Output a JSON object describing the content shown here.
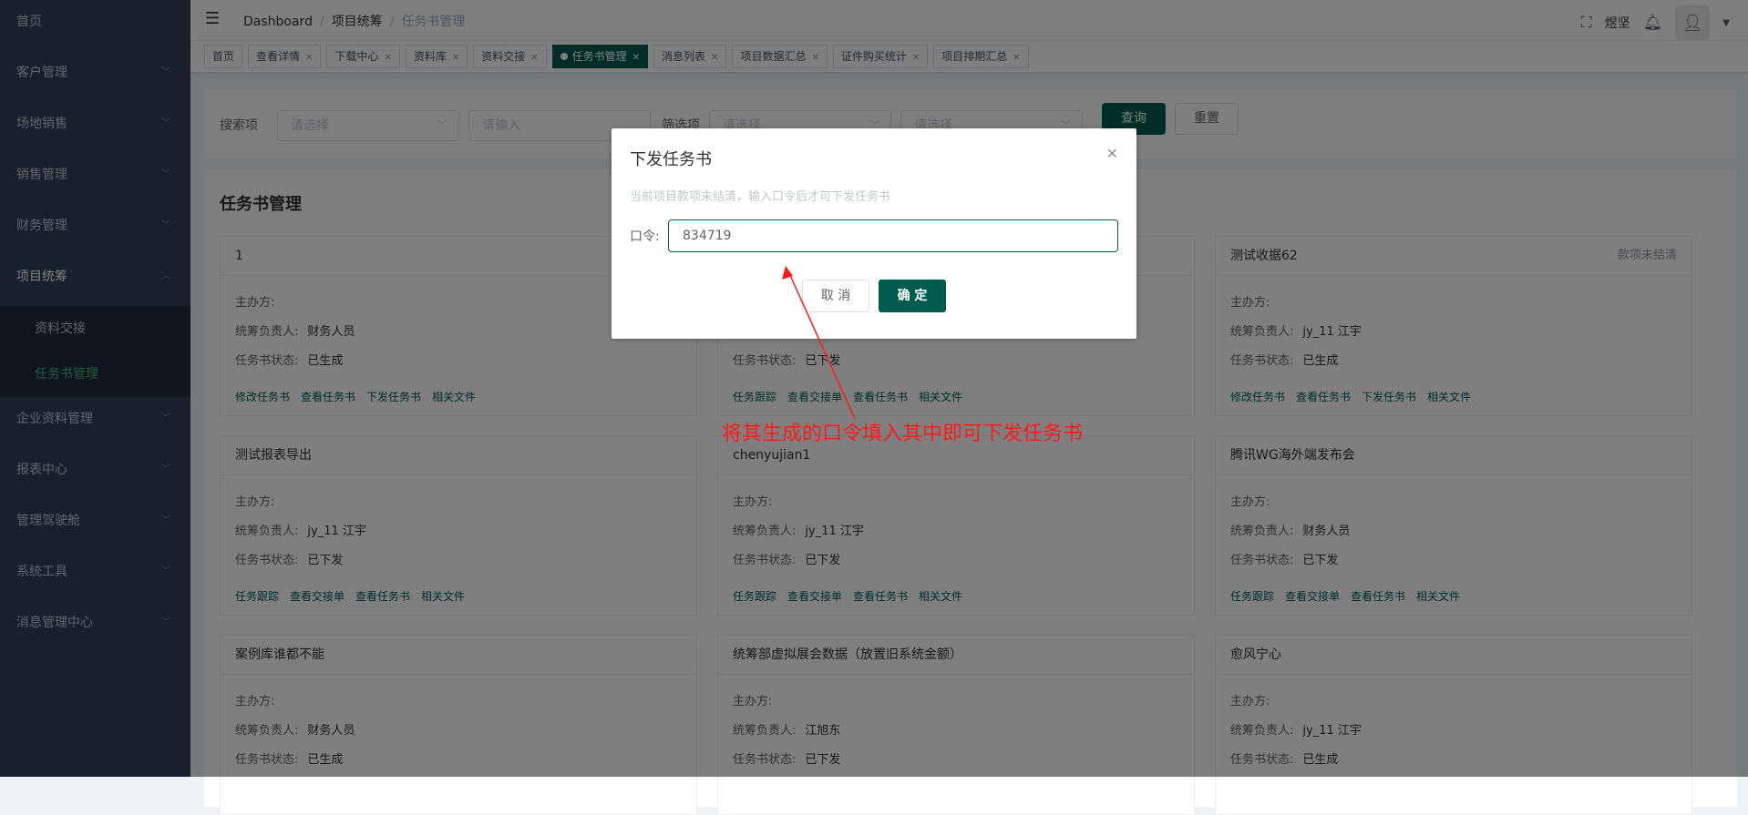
{
  "sidebar": {
    "items": [
      {
        "label": "首页",
        "chevron": false
      },
      {
        "label": "客户管理",
        "chevron": true
      },
      {
        "label": "场地销售",
        "chevron": true
      },
      {
        "label": "销售管理",
        "chevron": true
      },
      {
        "label": "财务管理",
        "chevron": true
      },
      {
        "label": "项目统筹",
        "chevron": true
      },
      {
        "label": "企业资料管理",
        "chevron": true
      },
      {
        "label": "报表中心",
        "chevron": true
      },
      {
        "label": "管理驾驶舱",
        "chevron": true
      },
      {
        "label": "系统工具",
        "chevron": true
      },
      {
        "label": "消息管理中心",
        "chevron": true
      }
    ],
    "subitems": [
      "资料交接",
      "任务书管理"
    ]
  },
  "navbar": {
    "breadcrumb": [
      "Dashboard",
      "项目统筹",
      "任务书管理"
    ],
    "user": "煜坚"
  },
  "tags": [
    {
      "label": "首页",
      "closable": false,
      "active": false
    },
    {
      "label": "查看详情",
      "closable": true,
      "active": false
    },
    {
      "label": "下载中心",
      "closable": true,
      "active": false
    },
    {
      "label": "资料库",
      "closable": true,
      "active": false
    },
    {
      "label": "资料交接",
      "closable": true,
      "active": false
    },
    {
      "label": "任务书管理",
      "closable": true,
      "active": true
    },
    {
      "label": "消息列表",
      "closable": true,
      "active": false
    },
    {
      "label": "项目数据汇总",
      "closable": true,
      "active": false
    },
    {
      "label": "证件购买统计",
      "closable": true,
      "active": false
    },
    {
      "label": "项目排期汇总",
      "closable": true,
      "active": false
    }
  ],
  "search": {
    "search_label": "搜索项",
    "select_placeholder": "请选择",
    "input_placeholder": "请输入",
    "filter_label": "筛选项",
    "filter1_placeholder": "请选择",
    "filter2_placeholder": "请选择",
    "query_label": "查询",
    "reset_label": "重置"
  },
  "list": {
    "title": "任务书管理",
    "field_labels": {
      "host": "主办方:",
      "owner": "统筹负责人:",
      "status": "任务书状态:"
    },
    "cards": [
      {
        "name": "1",
        "status_badge": "",
        "host": "",
        "owner": "财务人员",
        "task_status": "已生成",
        "actions": [
          "修改任务书",
          "查看任务书",
          "下发任务书",
          "相关文件"
        ]
      },
      {
        "name": "",
        "status_badge": "",
        "host": "",
        "owner": "",
        "task_status": "已下发",
        "actions": [
          "任务跟踪",
          "查看交接单",
          "查看任务书",
          "相关文件"
        ]
      },
      {
        "name": "测试收据62",
        "status_badge": "款项未结清",
        "host": "",
        "owner": "jy_11 江宇",
        "task_status": "已生成",
        "actions": [
          "修改任务书",
          "查看任务书",
          "下发任务书",
          "相关文件"
        ]
      },
      {
        "name": "测试报表导出",
        "status_badge": "",
        "host": "",
        "owner": "jy_11 江宇",
        "task_status": "已下发",
        "actions": [
          "任务跟踪",
          "查看交接单",
          "查看任务书",
          "相关文件"
        ]
      },
      {
        "name": "chenyujian1",
        "status_badge": "",
        "host": "",
        "owner": "jy_11 江宇",
        "task_status": "已下发",
        "actions": [
          "任务跟踪",
          "查看交接单",
          "查看任务书",
          "相关文件"
        ]
      },
      {
        "name": "腾讯WG海外端发布会",
        "status_badge": "",
        "host": "",
        "owner": "财务人员",
        "task_status": "已下发",
        "actions": [
          "任务跟踪",
          "查看交接单",
          "查看任务书",
          "相关文件"
        ]
      },
      {
        "name": "案例库谁都不能",
        "status_badge": "",
        "host": "",
        "owner": "财务人员",
        "task_status": "已生成",
        "actions": []
      },
      {
        "name": "统筹部虚拟展会数据（放置旧系统金额）",
        "status_badge": "",
        "host": "",
        "owner": "江旭东",
        "task_status": "已下发",
        "actions": []
      },
      {
        "name": "愈风宁心",
        "status_badge": "",
        "host": "",
        "owner": "jy_11 江宇",
        "task_status": "已生成",
        "actions": []
      }
    ]
  },
  "dialog": {
    "title": "下发任务书",
    "tip": "当前项目款项未结清，输入口令后才可下发任务书",
    "field_label": "口令:",
    "field_value": "834719",
    "cancel_label": "取 消",
    "ok_label": "确 定"
  },
  "annotation": {
    "text": "将其生成的口令填入其中即可下发任务书",
    "color": "#ff1a1a"
  },
  "colors": {
    "primary": "#005b4f",
    "sidebar": "#304156",
    "sidebar_active": "#41b883"
  }
}
